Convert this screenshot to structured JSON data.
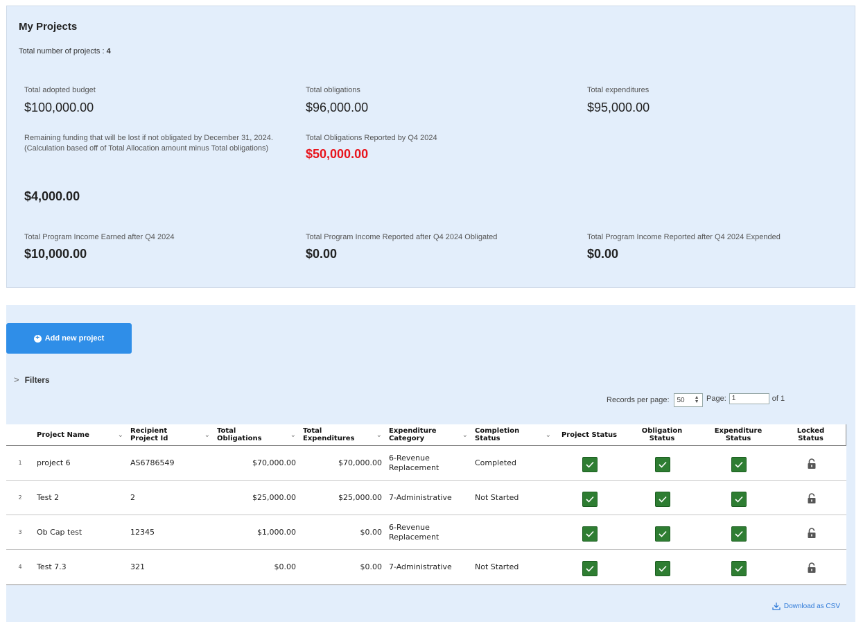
{
  "summary": {
    "title": "My Projects",
    "count_label": "Total number of projects :",
    "count_value": "4",
    "adopted_budget_label": "Total adopted budget",
    "adopted_budget_value": "$100,000.00",
    "obligations_label": "Total obligations",
    "obligations_value": "$96,000.00",
    "expenditures_label": "Total expenditures",
    "expenditures_value": "$95,000.00",
    "remaining_label_1": "Remaining funding that will be lost if not obligated by December 31, 2024.",
    "remaining_label_2": "(Calculation based off of Total Allocation amount minus Total obligations)",
    "remaining_value": "$4,000.00",
    "q4_obligations_label": "Total Obligations Reported by Q4 2024",
    "q4_obligations_value": "$50,000.00",
    "program_income_earned_label": "Total Program Income Earned after Q4 2024",
    "program_income_earned_value": "$10,000.00",
    "program_income_obligated_label": "Total Program Income Reported after Q4 2024 Obligated",
    "program_income_obligated_value": "$0.00",
    "program_income_expended_label": "Total Program Income Reported after Q4 2024 Expended",
    "program_income_expended_value": "$0.00"
  },
  "toolbar": {
    "add_project_label": "Add new project",
    "filters_label": "Filters",
    "records_per_page_label": "Records per page:",
    "records_per_page_value": "50",
    "page_label": "Page:",
    "page_value": "1",
    "page_of_label": "of 1",
    "download_csv_label": "Download as CSV"
  },
  "table": {
    "headers": {
      "project_name": "Project Name",
      "recipient_id": "Recipient Project Id",
      "total_obligations": "Total Obligations",
      "total_expenditures": "Total Expenditures",
      "expenditure_category": "Expenditure Category",
      "completion_status": "Completion Status",
      "project_status": "Project Status",
      "obligation_status": "Obligation Status",
      "expenditure_status": "Expenditure Status",
      "locked_status": "Locked Status"
    },
    "rows": [
      {
        "index": "1",
        "name": "project 6",
        "recipient_id": "AS6786549",
        "obligations": "$70,000.00",
        "expenditures": "$70,000.00",
        "category": "6-Revenue Replacement",
        "completion": "Completed"
      },
      {
        "index": "2",
        "name": "Test 2",
        "recipient_id": "2",
        "obligations": "$25,000.00",
        "expenditures": "$25,000.00",
        "category": "7-Administrative",
        "completion": "Not Started"
      },
      {
        "index": "3",
        "name": "Ob Cap test",
        "recipient_id": "12345",
        "obligations": "$1,000.00",
        "expenditures": "$0.00",
        "category": "6-Revenue Replacement",
        "completion": ""
      },
      {
        "index": "4",
        "name": "Test 7.3",
        "recipient_id": "321",
        "obligations": "$0.00",
        "expenditures": "$0.00",
        "category": "7-Administrative",
        "completion": "Not Started"
      }
    ]
  },
  "icons": {
    "status_check": "check-icon",
    "locked_status": "unlocked-padlock-icon"
  },
  "colors": {
    "panel_bg": "#e3eefb",
    "primary_button": "#2f8ee8",
    "warning_value": "#e8141c",
    "status_check": "#2e7d32"
  }
}
